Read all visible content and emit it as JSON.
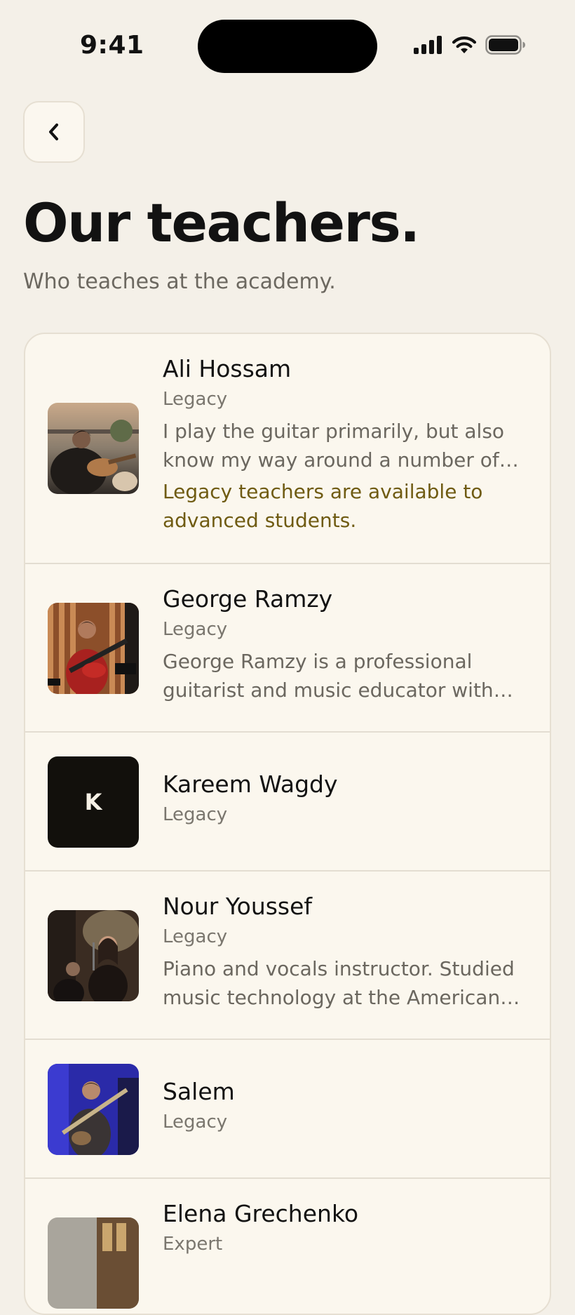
{
  "status_bar": {
    "time": "9:41"
  },
  "header": {
    "title": "Our teachers.",
    "subtitle": "Who teaches at the academy."
  },
  "teachers": [
    {
      "name": "Ali Hossam",
      "tier": "Legacy",
      "bio": "I play the guitar primarily, but also know my way around a number of o…",
      "note": "Legacy teachers are available to advanced students."
    },
    {
      "name": "George Ramzy",
      "tier": "Legacy",
      "bio": "George Ramzy is a professional guitarist and music educator with 6…"
    },
    {
      "name": "Kareem Wagdy",
      "tier": "Legacy",
      "avatar_initial": "K"
    },
    {
      "name": "Nour Youssef",
      "tier": "Legacy",
      "bio": "Piano and vocals instructor. Studied music technology at the American…"
    },
    {
      "name": "Salem",
      "tier": "Legacy"
    },
    {
      "name": "Elena Grechenko",
      "tier": "Expert"
    }
  ],
  "colors": {
    "background": "#f4f0e8",
    "card": "#fbf7ee",
    "accent_note": "#6f5b12",
    "text": "#121212",
    "muted": "#6b675f"
  }
}
